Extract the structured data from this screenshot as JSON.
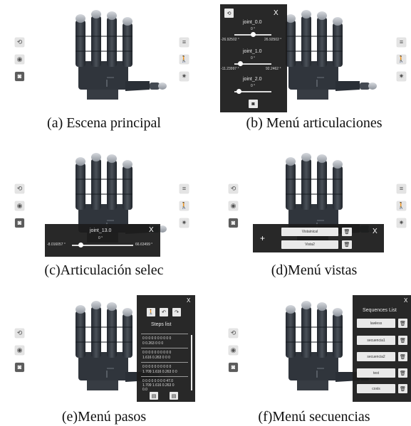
{
  "captions": {
    "a": "(a) Escena principal",
    "b": "(b) Menú articulaciones",
    "c": "(c)Articulación selec",
    "d": "(d)Menú vistas",
    "e": "(e)Menú pasos",
    "f": "(f)Menú secuencias"
  },
  "icons": {
    "reset": "⟲",
    "target": "◉",
    "camera": "◙",
    "menu": "≡",
    "walk": "🚶",
    "gear": "✷",
    "close": "X",
    "plus": "+",
    "trash": "🗑",
    "undo": "↶",
    "redo": "↷",
    "hand": "✋",
    "add_step": "▤",
    "list": "▤"
  },
  "joints_menu": {
    "close": "X",
    "joints": [
      {
        "name": "joint_0.0",
        "value": "0 °",
        "min": "-26.92502 °",
        "max": "26.92502 °",
        "fraction": 0.5
      },
      {
        "name": "joint_1.0",
        "value": "0 °",
        "min": "-11.23997 °",
        "max": "92.2462 °",
        "fraction": 0.11
      },
      {
        "name": "joint_2.0",
        "value": "0 °",
        "min": "",
        "max": "",
        "fraction": 0.07
      }
    ]
  },
  "selected_joint": {
    "name": "joint_13.0",
    "value": "0 °",
    "min": "-8.016057 °",
    "max": "66.63499 °",
    "fraction": 0.12,
    "close": "X"
  },
  "views_menu": {
    "plus": "+",
    "close": "X",
    "views": [
      "Vistainical",
      "Vista2"
    ]
  },
  "steps_menu": {
    "close": "X",
    "title": "Steps list",
    "steps": [
      {
        "line1": "0 0 0 0 0 0 0 0 0 0",
        "line2": "0 0.263 0 0 0"
      },
      {
        "line1": "0 0 0 0 0 0 0 0 0 0",
        "line2": "1.616 0.263 0 0 0"
      },
      {
        "line1": "0 0 0 0 0 0 0 0 0 0",
        "line2": "1.709 1.616 0.263 0 0"
      },
      {
        "line1": "0 0 0 0 0 0 0 0 47.0",
        "line2": "1.709 1.616 0.263 0",
        "line3": "0.0"
      }
    ]
  },
  "sequences_menu": {
    "close": "X",
    "title": "Sequences List",
    "sequences": [
      "lawless",
      "secuencia1",
      "secuencia2",
      "test",
      "coxis"
    ]
  }
}
